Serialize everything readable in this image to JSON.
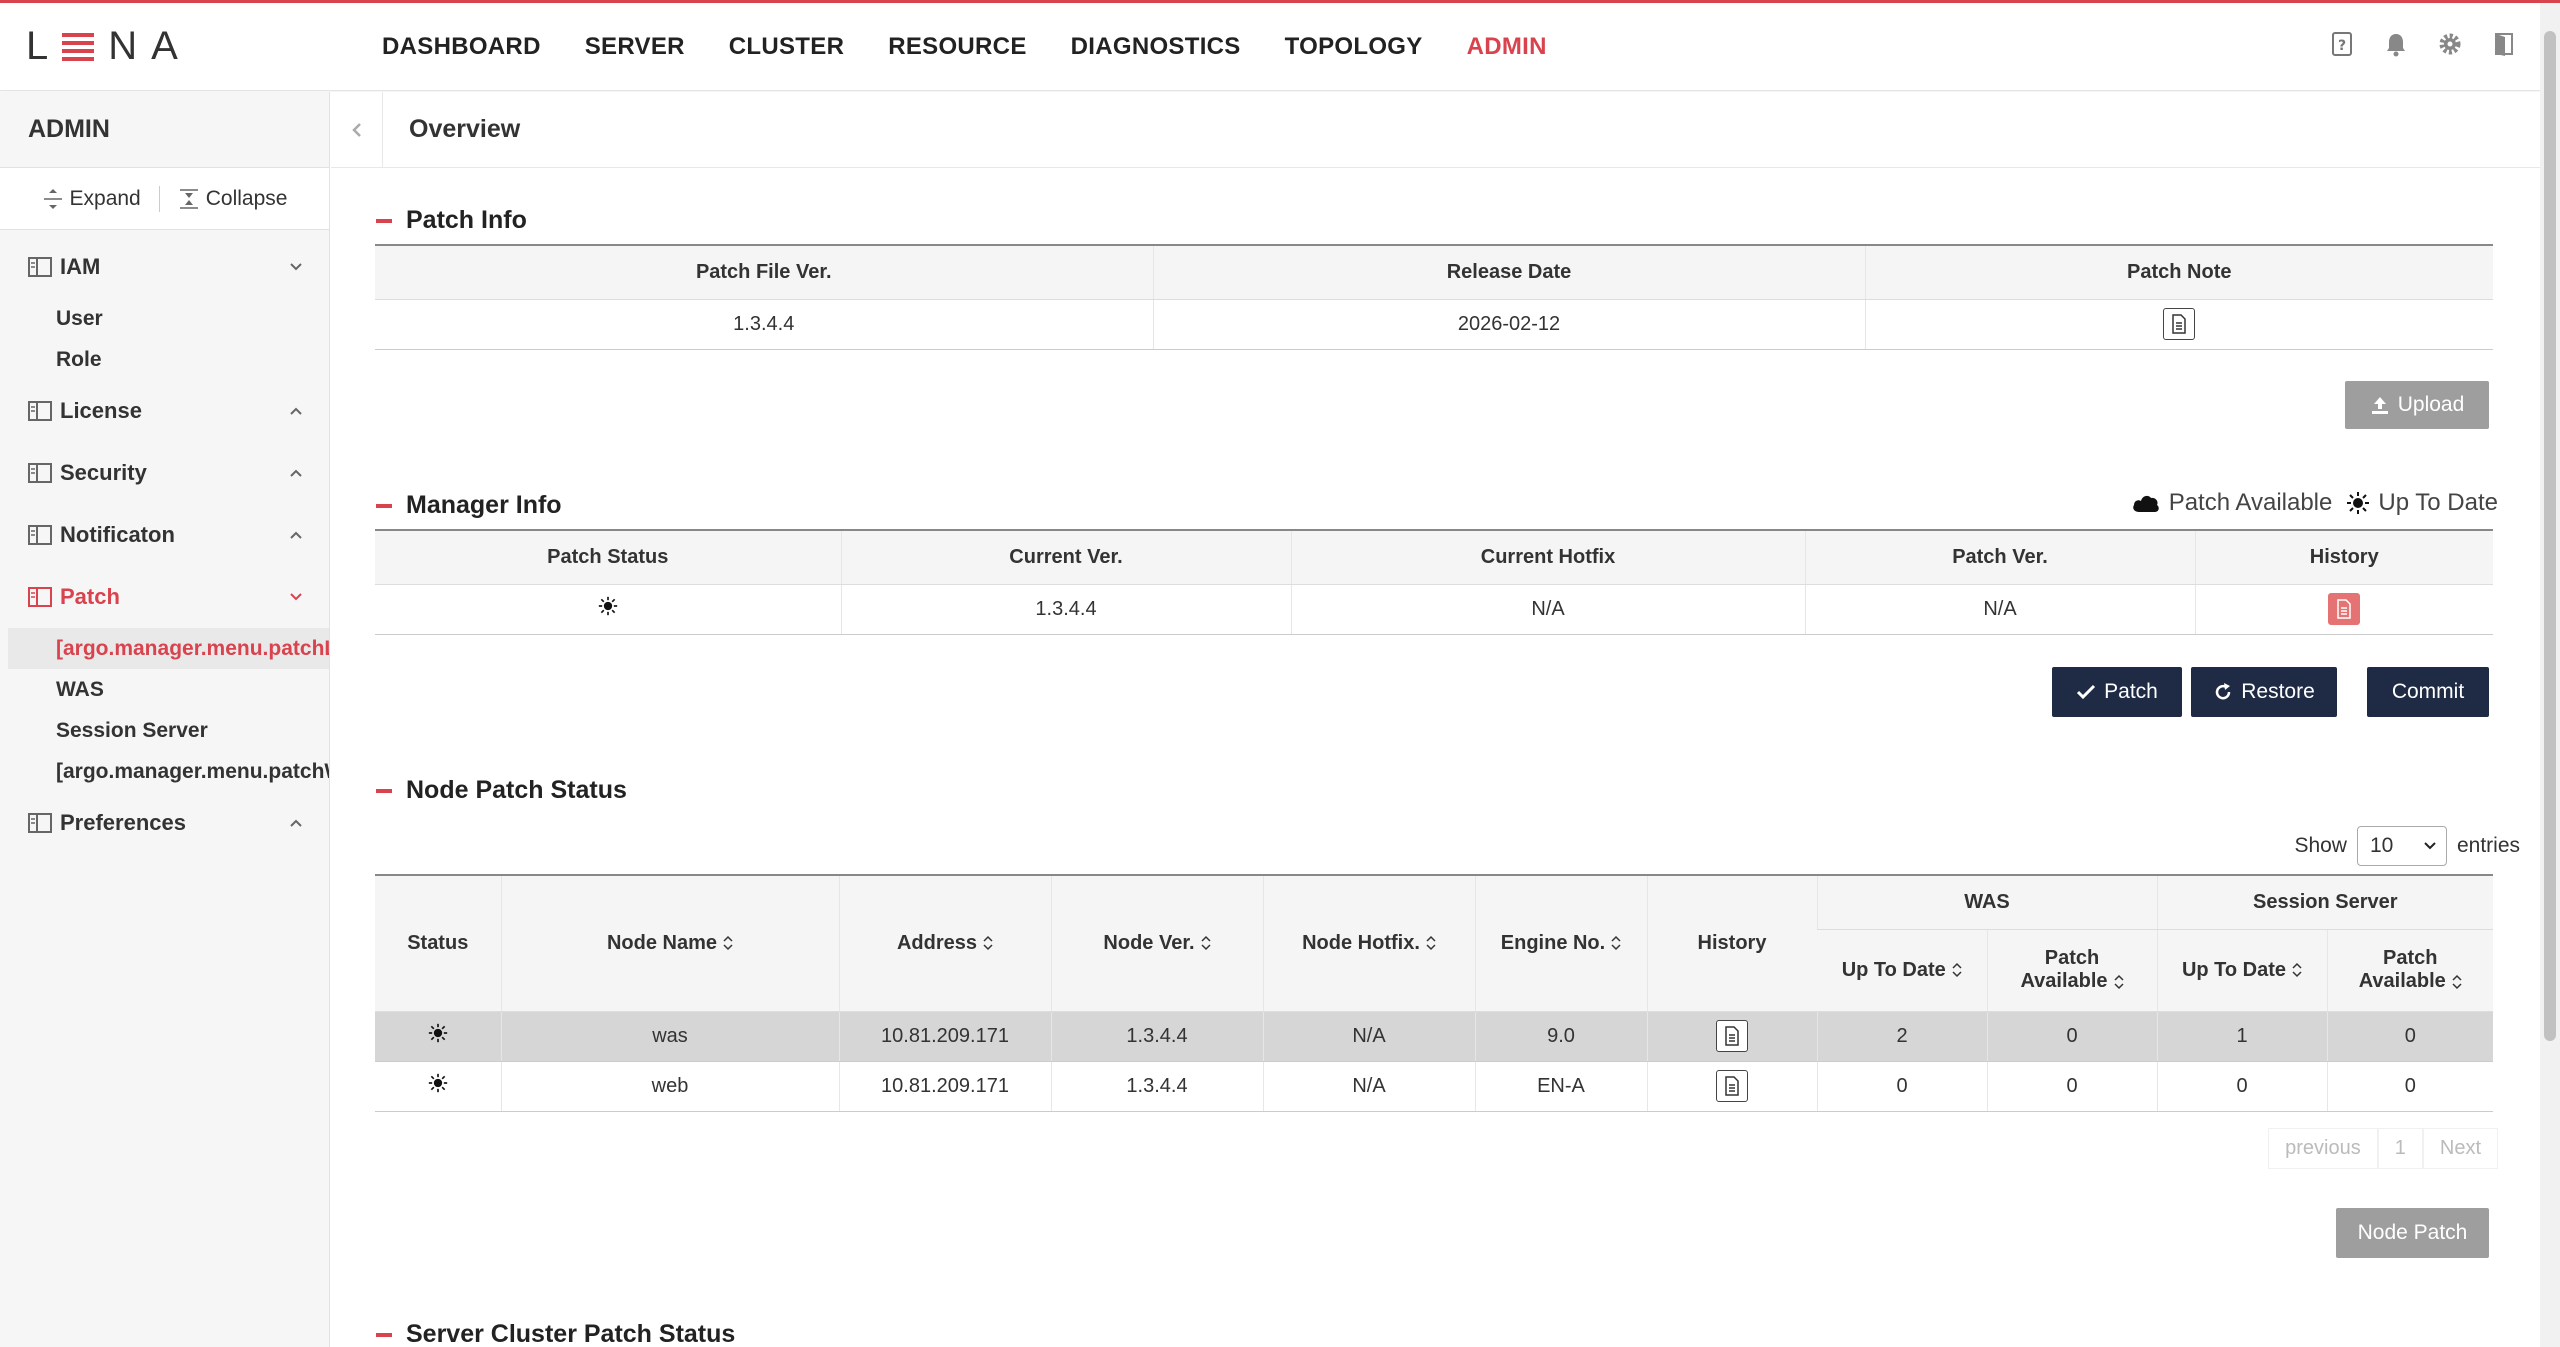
{
  "brand": {
    "logo": "LENA"
  },
  "nav": [
    "DASHBOARD",
    "SERVER",
    "CLUSTER",
    "RESOURCE",
    "DIAGNOSTICS",
    "TOPOLOGY",
    "ADMIN"
  ],
  "nav_active": "ADMIN",
  "sidebar": {
    "title": "ADMIN",
    "expand_label": "Expand",
    "collapse_label": "Collapse",
    "groups": [
      {
        "label": "IAM",
        "subs": [
          "User",
          "Role"
        ]
      },
      {
        "label": "License",
        "subs": []
      },
      {
        "label": "Security",
        "subs": []
      },
      {
        "label": "Notificaton",
        "subs": []
      },
      {
        "label": "Patch",
        "subs": [
          "[argo.manager.menu.patchL",
          "WAS",
          "Session Server",
          "[argo.manager.menu.patchW"
        ]
      },
      {
        "label": "Preferences",
        "subs": []
      }
    ]
  },
  "page": {
    "title": "Overview"
  },
  "patch_info": {
    "title": "Patch Info",
    "headers": [
      "Patch File Ver.",
      "Release Date",
      "Patch Note"
    ],
    "row": {
      "version": "1.3.4.4",
      "release_date": "2026-02-12"
    },
    "upload_label": "Upload"
  },
  "manager_info": {
    "title": "Manager Info",
    "legend_available": "Patch Available",
    "legend_uptodate": "Up To Date",
    "headers": [
      "Patch Status",
      "Current Ver.",
      "Current Hotfix",
      "Patch Ver.",
      "History"
    ],
    "row": {
      "current_ver": "1.3.4.4",
      "current_hotfix": "N/A",
      "patch_ver": "N/A"
    },
    "patch_label": "Patch",
    "restore_label": "Restore",
    "commit_label": "Commit"
  },
  "node_patch": {
    "title": "Node Patch Status",
    "show_label": "Show",
    "entries_value": "10",
    "entries_label": "entries",
    "headers": {
      "status": "Status",
      "node_name": "Node Name",
      "address": "Address",
      "node_ver": "Node Ver.",
      "node_hotfix": "Node Hotfix.",
      "engine_no": "Engine No.",
      "history": "History",
      "was": "WAS",
      "session": "Session Server",
      "up_to_date": "Up To Date",
      "patch_available_1": "Patch",
      "patch_available_2": "Available"
    },
    "rows": [
      {
        "name": "was",
        "address": "10.81.209.171",
        "node_ver": "1.3.4.4",
        "hotfix": "N/A",
        "engine": "9.0",
        "was_up": "2",
        "was_avail": "0",
        "ss_up": "1",
        "ss_avail": "0"
      },
      {
        "name": "web",
        "address": "10.81.209.171",
        "node_ver": "1.3.4.4",
        "hotfix": "N/A",
        "engine": "EN-A",
        "was_up": "0",
        "was_avail": "0",
        "ss_up": "0",
        "ss_avail": "0"
      }
    ],
    "pager": {
      "previous": "previous",
      "page": "1",
      "next": "Next"
    },
    "node_patch_label": "Node Patch"
  },
  "server_cluster": {
    "title": "Server Cluster Patch Status"
  },
  "colors": {
    "accent": "#d8434e",
    "navy": "#1f2a44",
    "gray_button": "#9e9e9e"
  }
}
